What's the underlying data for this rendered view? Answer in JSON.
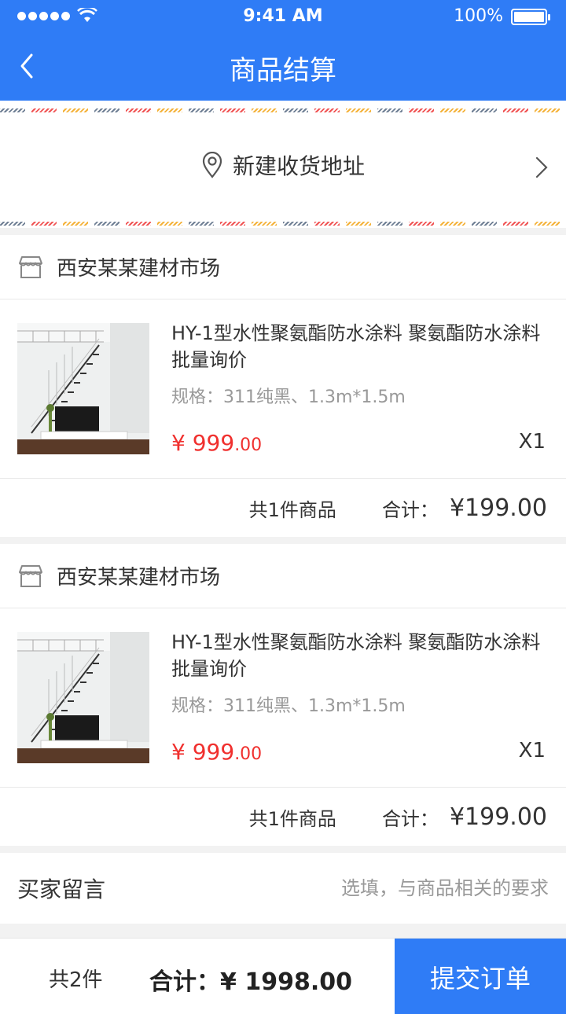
{
  "status_bar": {
    "time": "9:41 AM",
    "battery": "100%"
  },
  "header": {
    "title": "商品结算"
  },
  "address": {
    "label": "新建收货地址"
  },
  "orders": [
    {
      "shop_name": "西安某某建材市场",
      "item": {
        "title": "HY-1型水性聚氨酯防水涂料 聚氨酯防水涂料批量询价",
        "spec": "规格：311纯黑、1.3m*1.5m",
        "price_symbol": "¥",
        "price_int": "999",
        "price_dec": ".00",
        "qty": "X1"
      },
      "summary": {
        "count": "共1件商品",
        "total_label": "合计：",
        "total_value": "¥199.00"
      }
    },
    {
      "shop_name": "西安某某建材市场",
      "item": {
        "title": "HY-1型水性聚氨酯防水涂料 聚氨酯防水涂料批量询价",
        "spec": "规格：311纯黑、1.3m*1.5m",
        "price_symbol": "¥",
        "price_int": "999",
        "price_dec": ".00",
        "qty": "X1"
      },
      "summary": {
        "count": "共1件商品",
        "total_label": "合计：",
        "total_value": "¥199.00"
      }
    }
  ],
  "memo": {
    "label": "买家留言",
    "placeholder": "选填，与商品相关的要求"
  },
  "footer": {
    "count": "共2件",
    "total": "合计：¥ 1998.00",
    "submit_label": "提交订单"
  },
  "colors": {
    "primary": "#2f7cf6",
    "price": "#f0302e"
  },
  "icons": {
    "back": "chevron-left-icon",
    "location": "location-pin-icon",
    "forward": "chevron-right-icon",
    "shop": "store-icon"
  }
}
